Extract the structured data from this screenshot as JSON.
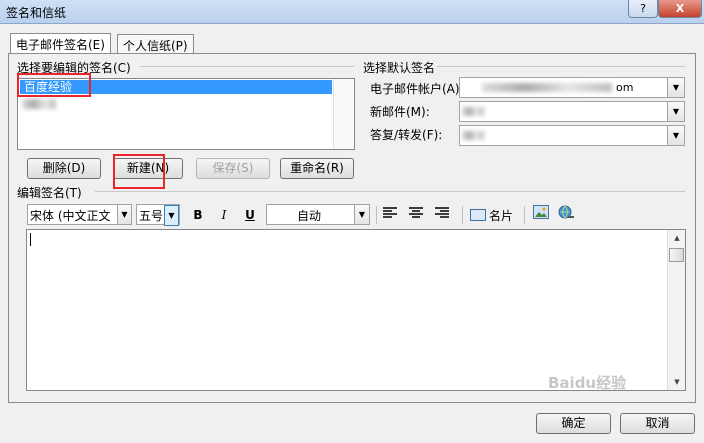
{
  "window": {
    "title": "签名和信纸",
    "help": "?",
    "close": "X"
  },
  "tabs": [
    {
      "label": "电子邮件签名(E)"
    },
    {
      "label": "个人信纸(P)"
    }
  ],
  "select_section": {
    "label": "选择要编辑的签名(C)",
    "items": [
      "百度经验"
    ],
    "buttons": {
      "delete": "删除(D)",
      "new": "新建(N)",
      "save": "保存(S)",
      "rename": "重命名(R)"
    }
  },
  "default_section": {
    "label": "选择默认签名",
    "account_label": "电子邮件帐户(A):",
    "account_value": "om",
    "new_msg_label": "新邮件(M):",
    "reply_label": "答复/转发(F):"
  },
  "edit_section": {
    "label": "编辑签名(T)",
    "font": "宋体 (中文正文",
    "size": "五号",
    "bold": "B",
    "italic": "I",
    "underline": "U",
    "color": "自动",
    "card": "名片"
  },
  "footer": {
    "ok": "确定",
    "cancel": "取消"
  },
  "watermark": "Baidu经验"
}
